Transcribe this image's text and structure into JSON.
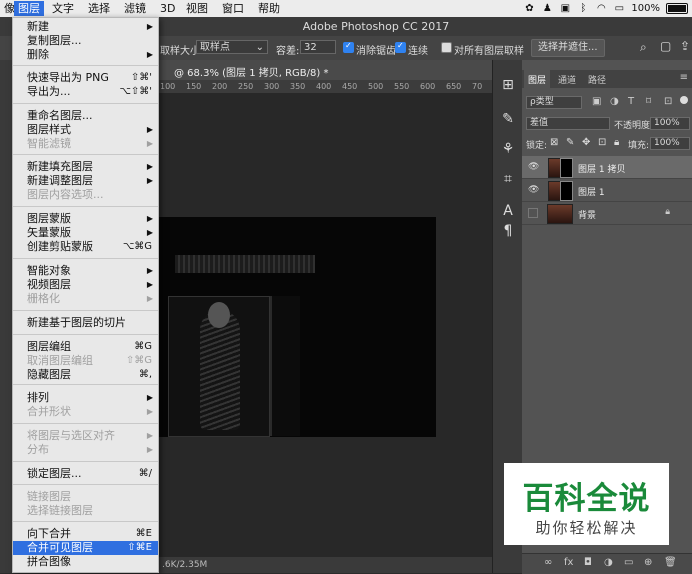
{
  "menubar": {
    "items": [
      "像",
      "图层",
      "文字",
      "选择",
      "滤镜",
      "3D",
      "视图",
      "窗口",
      "帮助"
    ],
    "battery": "100%"
  },
  "ps_title": "Adobe Photoshop CC 2017",
  "options": {
    "sample_size_label": "取样大小:",
    "sample_size_value": "取样点",
    "tolerance_label": "容差:",
    "tolerance_value": "32",
    "anti_alias_label": "消除锯齿",
    "contiguous_label": "连续",
    "sample_all_layers_label": "对所有图层取样",
    "select_mask_button": "选择并遮住..."
  },
  "document": {
    "tab_title": "@ 68.3% (图层 1 拷贝, RGB/8) *",
    "ruler_ticks": [
      "100",
      "150",
      "200",
      "250",
      "300",
      "350",
      "400",
      "450",
      "500",
      "550",
      "600",
      "650",
      "70"
    ],
    "status": ".6K/2.35M"
  },
  "layers_panel": {
    "tabs": [
      "图层",
      "通道",
      "路径"
    ],
    "filter_label": "ρ类型",
    "blend_mode": "差值",
    "opacity_label": "不透明度:",
    "opacity_value": "100%",
    "lock_label": "锁定:",
    "fill_label": "填充:",
    "fill_value": "100%",
    "layers": [
      {
        "name": "图层 1 拷贝",
        "visible": true,
        "selected": true
      },
      {
        "name": "图层 1",
        "visible": true,
        "selected": false
      },
      {
        "name": "背景",
        "visible": false,
        "selected": false,
        "locked": true
      }
    ],
    "bottom_icons": [
      "fx"
    ]
  },
  "menu": {
    "items": [
      {
        "label": "新建",
        "shortcut": "",
        "arrow": true,
        "disabled": false
      },
      {
        "label": "复制图层...",
        "shortcut": "",
        "arrow": false,
        "disabled": false
      },
      {
        "label": "删除",
        "shortcut": "",
        "arrow": true,
        "disabled": false
      },
      {
        "label": "快速导出为 PNG",
        "shortcut": "⇧⌘'",
        "arrow": false,
        "disabled": false
      },
      {
        "label": "导出为...",
        "shortcut": "⌥⇧⌘'",
        "arrow": false,
        "disabled": false
      },
      {
        "label": "重命名图层...",
        "shortcut": "",
        "arrow": false,
        "disabled": false
      },
      {
        "label": "图层样式",
        "shortcut": "",
        "arrow": true,
        "disabled": false
      },
      {
        "label": "智能滤镜",
        "shortcut": "",
        "arrow": true,
        "disabled": true
      },
      {
        "label": "新建填充图层",
        "shortcut": "",
        "arrow": true,
        "disabled": false
      },
      {
        "label": "新建调整图层",
        "shortcut": "",
        "arrow": true,
        "disabled": false
      },
      {
        "label": "图层内容选项...",
        "shortcut": "",
        "arrow": false,
        "disabled": true
      },
      {
        "label": "图层蒙版",
        "shortcut": "",
        "arrow": true,
        "disabled": false
      },
      {
        "label": "矢量蒙版",
        "shortcut": "",
        "arrow": true,
        "disabled": false
      },
      {
        "label": "创建剪贴蒙版",
        "shortcut": "⌥⌘G",
        "arrow": false,
        "disabled": false
      },
      {
        "label": "智能对象",
        "shortcut": "",
        "arrow": true,
        "disabled": false
      },
      {
        "label": "视频图层",
        "shortcut": "",
        "arrow": true,
        "disabled": false
      },
      {
        "label": "栅格化",
        "shortcut": "",
        "arrow": true,
        "disabled": true
      },
      {
        "label": "新建基于图层的切片",
        "shortcut": "",
        "arrow": false,
        "disabled": false
      },
      {
        "label": "图层编组",
        "shortcut": "⌘G",
        "arrow": false,
        "disabled": false
      },
      {
        "label": "取消图层编组",
        "shortcut": "⇧⌘G",
        "arrow": false,
        "disabled": true
      },
      {
        "label": "隐藏图层",
        "shortcut": "⌘,",
        "arrow": false,
        "disabled": false
      },
      {
        "label": "排列",
        "shortcut": "",
        "arrow": true,
        "disabled": false
      },
      {
        "label": "合并形状",
        "shortcut": "",
        "arrow": true,
        "disabled": true
      },
      {
        "label": "将图层与选区对齐",
        "shortcut": "",
        "arrow": true,
        "disabled": true
      },
      {
        "label": "分布",
        "shortcut": "",
        "arrow": true,
        "disabled": true
      },
      {
        "label": "锁定图层...",
        "shortcut": "⌘/",
        "arrow": false,
        "disabled": false
      },
      {
        "label": "链接图层",
        "shortcut": "",
        "arrow": false,
        "disabled": true
      },
      {
        "label": "选择链接图层",
        "shortcut": "",
        "arrow": false,
        "disabled": true
      },
      {
        "label": "向下合并",
        "shortcut": "⌘E",
        "arrow": false,
        "disabled": false
      },
      {
        "label": "合并可见图层",
        "shortcut": "⇧⌘E",
        "arrow": false,
        "disabled": false,
        "highlighted": true
      },
      {
        "label": "拼合图像",
        "shortcut": "",
        "arrow": false,
        "disabled": false
      }
    ]
  },
  "watermark": {
    "main": "百科全说",
    "sub": "助你轻松解决"
  },
  "colors": {
    "accent": "#2f6fe0",
    "watermark_green": "#1a8a3a"
  }
}
